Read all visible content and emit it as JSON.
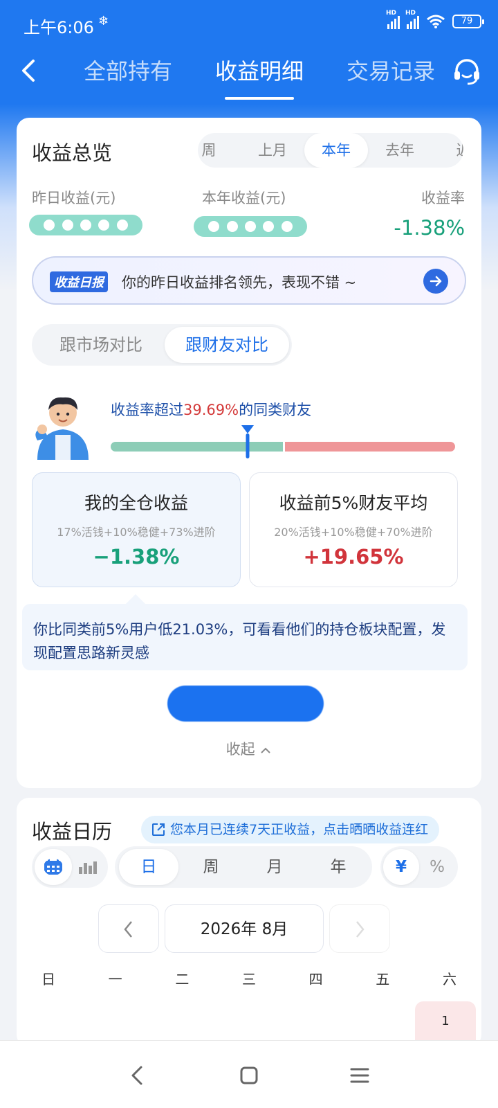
{
  "status_bar": {
    "time": "上午6:06",
    "weather_glyph": "❄",
    "signal_label": "HD",
    "battery": "79"
  },
  "nav": {
    "tabs": [
      {
        "label": "全部持有"
      },
      {
        "label": "收益明细"
      },
      {
        "label": "交易记录"
      }
    ],
    "active_tab": "收益明细"
  },
  "overview": {
    "title": "收益总览",
    "periods": [
      "周",
      "上月",
      "本年",
      "去年",
      "近"
    ],
    "active_period": "本年",
    "yesterday_label": "昨日收益(元)",
    "year_label": "本年收益(元)",
    "rate_label": "收益率",
    "rate_value": "-1.38%"
  },
  "daily_report": {
    "tag": "收益日报",
    "text": "你的昨日收益排名领先，表现不错 ~"
  },
  "compare": {
    "options": [
      "跟市场对比",
      "跟财友对比"
    ],
    "active": "跟财友对比",
    "beat_prefix": "收益率超过",
    "beat_value": "39.69%",
    "beat_suffix": "的同类财友",
    "percentile": 0.3969,
    "mine": {
      "title": "我的全仓收益",
      "allocation": "17%活钱+10%稳健+73%进阶",
      "value": "−1.38%"
    },
    "top": {
      "title": "收益前5%财友平均",
      "allocation": "20%活钱+10%稳健+70%进阶",
      "value": "+19.65%"
    },
    "tip": "你比同类前5%用户低21.03%，可看看他们的持仓板块配置，发现配置思路新灵感",
    "cta": "",
    "collapse": "收起"
  },
  "calendar": {
    "title": "收益日历",
    "streak": "您本月已连续7天正收益，点击晒晒收益连红",
    "granularity": [
      "日",
      "周",
      "月",
      "年"
    ],
    "active_granularity": "日",
    "unit_options": [
      "¥",
      "%"
    ],
    "active_unit": "¥",
    "month": "2026年 8月",
    "weekdays": [
      "日",
      "一",
      "二",
      "三",
      "四",
      "五",
      "六"
    ],
    "first_day": "1"
  },
  "colors": {
    "brand_blue": "#1f78f0",
    "gain_red": "#d1343b",
    "loss_green": "#18a07a"
  }
}
